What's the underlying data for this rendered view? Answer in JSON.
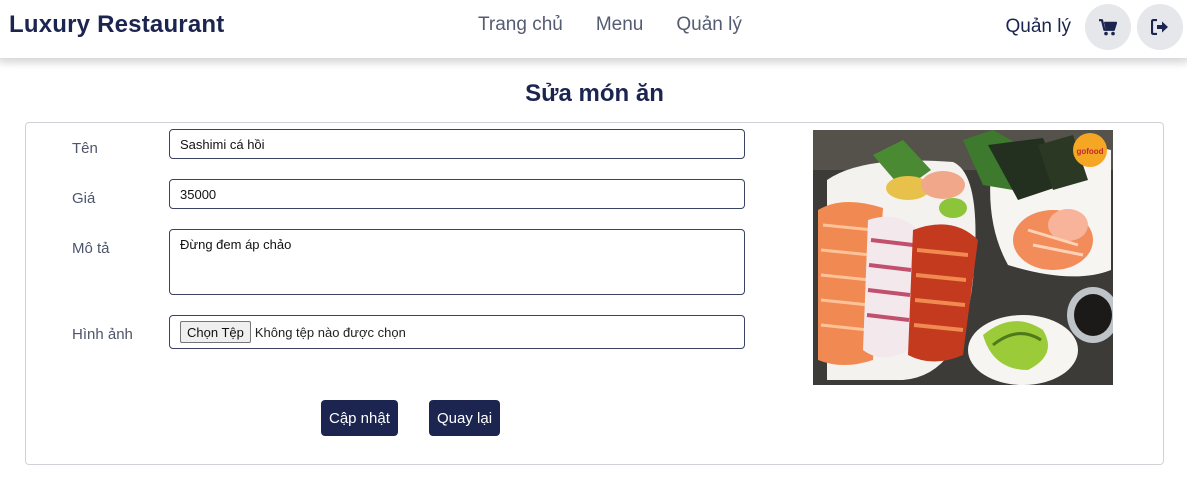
{
  "navbar": {
    "brand": "Luxury Restaurant",
    "links": [
      "Trang chủ",
      "Menu",
      "Quản lý"
    ],
    "user_label": "Quản lý",
    "cart_icon": "cart-icon",
    "logout_icon": "logout-icon"
  },
  "page": {
    "title": "Sửa món ăn"
  },
  "form": {
    "name_label": "Tên",
    "name_value": "Sashimi cá hồi",
    "price_label": "Giá",
    "price_value": "35000",
    "description_label": "Mô tả",
    "description_value": "Đừng đem áp chảo",
    "image_label": "Hình ảnh",
    "file_button": "Chọn Tệp",
    "file_status": "Không tệp nào được chọn",
    "update_button": "Cập nhật",
    "back_button": "Quay lại"
  },
  "image": {
    "logo_text": "gofood"
  },
  "colors": {
    "primary": "#1b2550",
    "nav_button_bg": "#e6e7eb"
  }
}
